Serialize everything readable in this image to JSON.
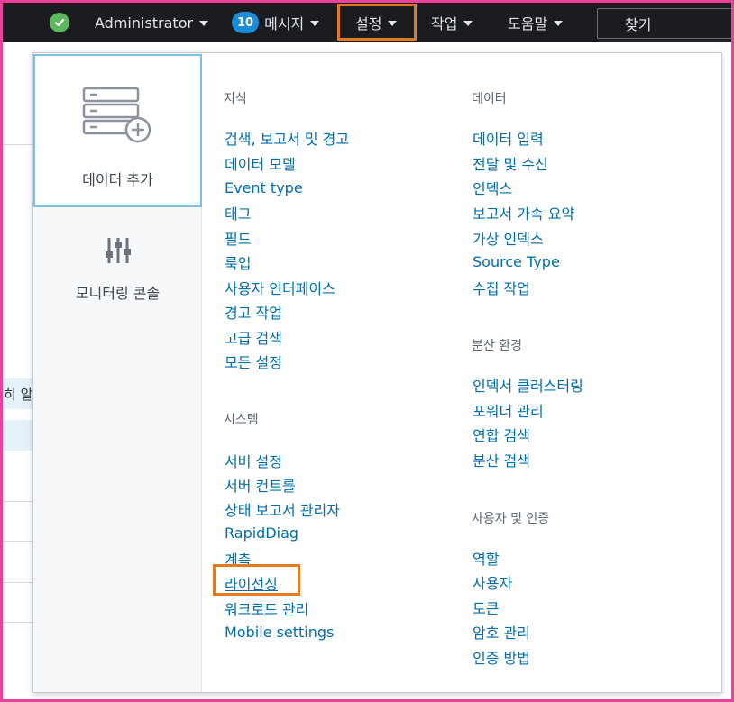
{
  "topbar": {
    "user": "Administrator",
    "messages_count": "10",
    "messages_label": "메시지",
    "settings_label": "설정",
    "activity_label": "작업",
    "help_label": "도움말",
    "search_label": "찾기"
  },
  "background": {
    "partial_text": "히 알"
  },
  "dropdown": {
    "tiles": [
      {
        "label": "데이터 추가"
      },
      {
        "label": "모니터링 콘솔"
      }
    ],
    "knowledge": {
      "heading": "지식",
      "items": [
        "검색, 보고서 및 경고",
        "데이터 모델",
        "Event type",
        "태그",
        "필드",
        "룩업",
        "사용자 인터페이스",
        "경고 작업",
        "고급 검색",
        "모든 설정"
      ]
    },
    "system": {
      "heading": "시스템",
      "items": [
        "서버 설정",
        "서버 컨트롤",
        "상태 보고서 관리자",
        "RapidDiag",
        "계측",
        "라이선싱",
        "워크로드 관리",
        "Mobile settings"
      ]
    },
    "data": {
      "heading": "데이터",
      "items": [
        "데이터 입력",
        "전달 및 수신",
        "인덱스",
        "보고서 가속 요약",
        "가상 인덱스",
        "Source Type",
        "수집 작업"
      ]
    },
    "distributed": {
      "heading": "분산 환경",
      "items": [
        "인덱서 클러스터링",
        "포워더 관리",
        "연합 검색",
        "분산 검색"
      ]
    },
    "users_auth": {
      "heading": "사용자 및 인증",
      "items": [
        "역할",
        "사용자",
        "토큰",
        "암호 관리",
        "인증 방법"
      ]
    }
  },
  "colors": {
    "topbar_bg": "#1a1c20",
    "link": "#006eaa",
    "highlight": "#e07b22",
    "frame": "#e8429a",
    "active_tile_border": "#7fc0e6"
  },
  "icons": [
    "check-circle-icon",
    "caret-down-icon",
    "search-icon",
    "server-add-icon",
    "sliders-icon"
  ]
}
